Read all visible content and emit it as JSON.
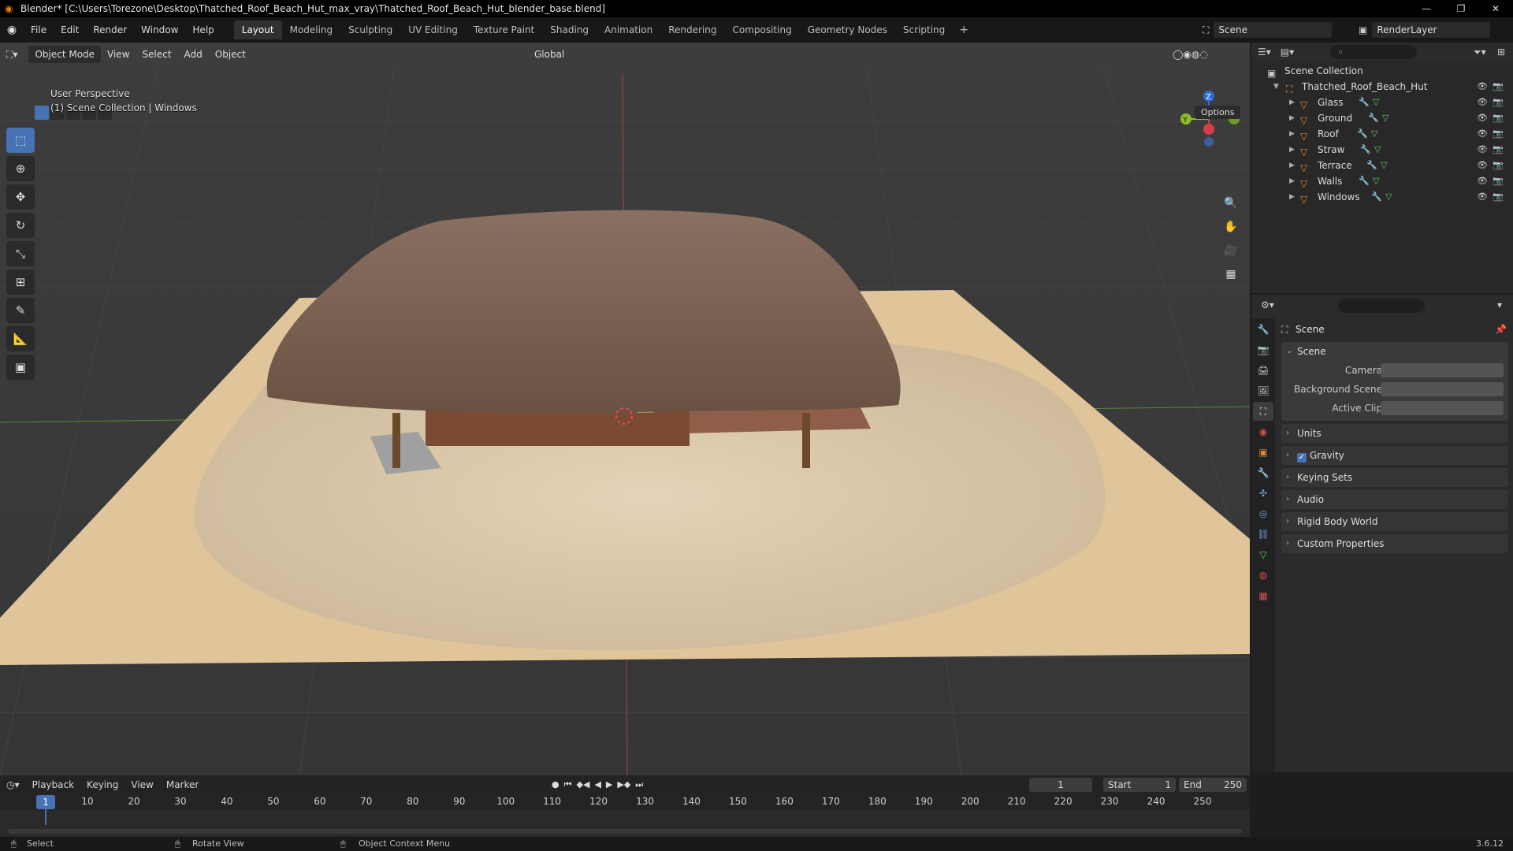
{
  "window": {
    "title": "Blender* [C:\\Users\\Torezone\\Desktop\\Thatched_Roof_Beach_Hut_max_vray\\Thatched_Roof_Beach_Hut_blender_base.blend]",
    "minimize": "—",
    "restore": "❐",
    "close": "✕"
  },
  "menu": {
    "items": [
      "File",
      "Edit",
      "Render",
      "Window",
      "Help"
    ],
    "workspaces": [
      "Layout",
      "Modeling",
      "Sculpting",
      "UV Editing",
      "Texture Paint",
      "Shading",
      "Animation",
      "Rendering",
      "Compositing",
      "Geometry Nodes",
      "Scripting"
    ],
    "active_workspace": "Layout",
    "add_workspace": "+",
    "scene": "Scene",
    "render_layer": "RenderLayer"
  },
  "viewport": {
    "mode": "Object Mode",
    "header_menus": [
      "View",
      "Select",
      "Add",
      "Object"
    ],
    "orientation": "Global",
    "options": "Options",
    "info_line1": "User Perspective",
    "info_line2": "(1) Scene Collection | Windows",
    "gizmo": {
      "z": "Z",
      "y": "Y"
    }
  },
  "outliner": {
    "root": "Scene Collection",
    "collection": "Thatched_Roof_Beach_Hut",
    "objects": [
      "Glass",
      "Ground",
      "Roof",
      "Straw",
      "Terrace",
      "Walls",
      "Windows"
    ]
  },
  "properties": {
    "context": "Scene",
    "panel_scene": "Scene",
    "camera_label": "Camera",
    "background_scene_label": "Background Scene",
    "active_clip_label": "Active Clip",
    "collapsed_panels": [
      "Units",
      "Gravity",
      "Keying Sets",
      "Audio",
      "Rigid Body World",
      "Custom Properties"
    ],
    "gravity_checked": true
  },
  "timeline": {
    "menus": [
      "Playback",
      "Keying",
      "View",
      "Marker"
    ],
    "current_frame": "1",
    "start_label": "Start",
    "start": "1",
    "end_label": "End",
    "end": "250",
    "ticks": [
      "1",
      "10",
      "20",
      "30",
      "40",
      "50",
      "60",
      "70",
      "80",
      "90",
      "100",
      "110",
      "120",
      "130",
      "140",
      "150",
      "160",
      "170",
      "180",
      "190",
      "200",
      "210",
      "220",
      "230",
      "240",
      "250"
    ]
  },
  "status": {
    "select": "Select",
    "rotate": "Rotate View",
    "context_menu": "Object Context Menu",
    "version": "3.6.12"
  }
}
